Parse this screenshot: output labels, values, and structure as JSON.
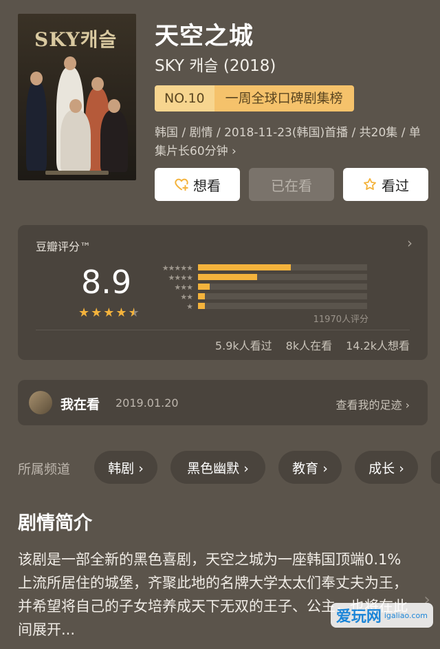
{
  "show": {
    "title": "天空之城",
    "subtitle": "SKY 캐슬 (2018)",
    "poster_title": "SKY캐슬",
    "rank_no": "NO.10",
    "rank_label": "一周全球口碑剧集榜",
    "meta": "韩国 / 剧情 / 2018-11-23(韩国)首播 / 共20集 / 单集片长60分钟 ›"
  },
  "actions": {
    "want": "想看",
    "watching": "已在看",
    "watched": "看过"
  },
  "rating": {
    "label": "豆瓣评分™",
    "score": "8.9",
    "stars": 4.5,
    "distribution": [
      {
        "stars": 5,
        "fraction": 0.55
      },
      {
        "stars": 4,
        "fraction": 0.35
      },
      {
        "stars": 3,
        "fraction": 0.07
      },
      {
        "stars": 2,
        "fraction": 0.04
      },
      {
        "stars": 1,
        "fraction": 0.04
      }
    ],
    "count": "11970人评分",
    "watched": "5.9k人看过",
    "watching": "8k人在看",
    "want": "14.2k人想看"
  },
  "my_status": {
    "status": "我在看",
    "date": "2019.01.20",
    "link": "查看我的足迹 ›"
  },
  "channels": {
    "label": "所属频道",
    "items": [
      "韩剧 ›",
      "黑色幽默 ›",
      "教育 ›",
      "成长 ›"
    ]
  },
  "synopsis": {
    "title": "剧情简介",
    "text": "该剧是一部全新的黑色喜剧，天空之城为一座韩国顶端0.1%上流所居住的城堡，齐聚此地的名牌大学太太们奉丈夫为王，并希望将自己的子女培养成天下无双的王子、公主，也将在此间展开..."
  },
  "watermark": {
    "main": "爱玩网",
    "sub": "igaliao.com"
  },
  "colors": {
    "background": "#5b544b",
    "card": "#4a443d",
    "star": "#f4b33c",
    "rank_badge": "#f5c26b"
  }
}
